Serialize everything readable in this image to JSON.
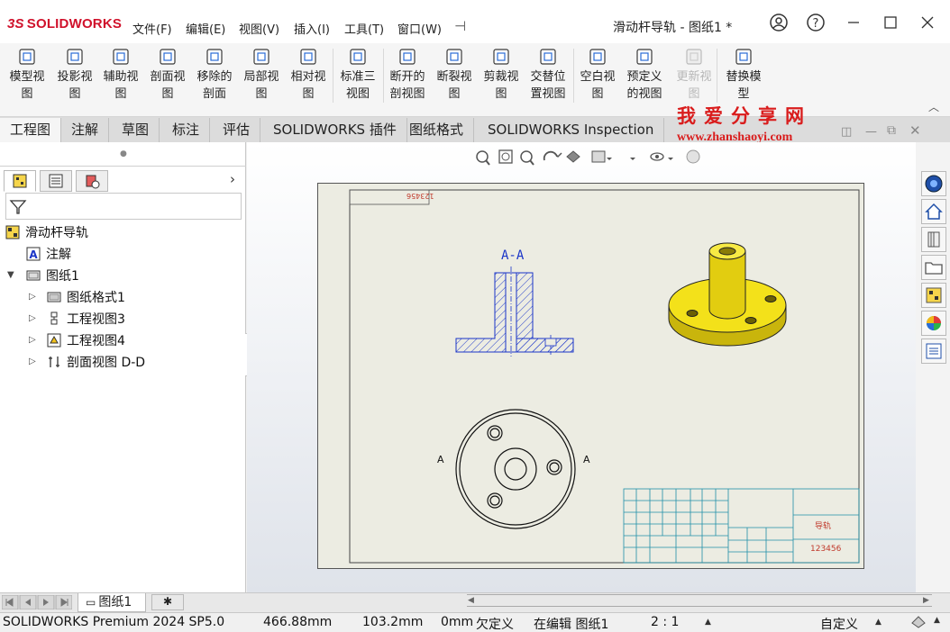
{
  "app": {
    "logo_prefix": "3S",
    "logo_text": "SOLIDWORKS",
    "window_title": "滑动杆导轨 - 图纸1 *"
  },
  "menu": [
    "文件(F)",
    "编辑(E)",
    "视图(V)",
    "插入(I)",
    "工具(T)",
    "窗口(W)"
  ],
  "ribbon": [
    {
      "line1": "模型视",
      "line2": "图",
      "icon": "model-view-icon"
    },
    {
      "line1": "投影视",
      "line2": "图",
      "icon": "projected-view-icon"
    },
    {
      "line1": "辅助视",
      "line2": "图",
      "icon": "auxiliary-view-icon"
    },
    {
      "line1": "剖面视",
      "line2": "图",
      "icon": "section-view-icon"
    },
    {
      "line1": "移除的",
      "line2": "剖面",
      "icon": "removed-section-icon"
    },
    {
      "line1": "局部视",
      "line2": "图",
      "icon": "detail-view-icon"
    },
    {
      "line1": "相对视",
      "line2": "图",
      "icon": "relative-view-icon"
    },
    {
      "line1": "标准三",
      "line2": "视图",
      "icon": "standard-3-view-icon"
    },
    {
      "line1": "断开的",
      "line2": "剖视图",
      "icon": "broken-out-section-icon"
    },
    {
      "line1": "断裂视",
      "line2": "图",
      "icon": "break-view-icon"
    },
    {
      "line1": "剪裁视",
      "line2": "图",
      "icon": "crop-view-icon"
    },
    {
      "line1": "交替位",
      "line2": "置视图",
      "icon": "alternate-position-icon"
    },
    {
      "line1": "空白视",
      "line2": "图",
      "icon": "empty-view-icon"
    },
    {
      "line1": "预定义",
      "line2": "的视图",
      "icon": "predefined-view-icon"
    },
    {
      "line1": "更新视",
      "line2": "图",
      "icon": "update-view-icon",
      "disabled": true
    },
    {
      "line1": "替换模",
      "line2": "型",
      "icon": "replace-model-icon"
    }
  ],
  "tabs": [
    "工程图",
    "注解",
    "草图",
    "标注",
    "评估",
    "SOLIDWORKS 插件",
    "图纸格式",
    "SOLIDWORKS Inspection"
  ],
  "watermark": {
    "line1": "我爱分享网",
    "line2": "www.zhanshaoyi.com"
  },
  "tree": {
    "root": "滑动杆导轨",
    "annotations": "注解",
    "sheet": "图纸1",
    "children": [
      "图纸格式1",
      "工程视图3",
      "工程视图4",
      "剖面视图 D-D"
    ]
  },
  "drawing": {
    "section_label": "A-A",
    "stamp": "123456",
    "title_name": "导轨",
    "title_number": "123456",
    "section_callout_left": "A",
    "section_callout_right": "A"
  },
  "sheet_tab": "图纸1",
  "status": {
    "product": "SOLIDWORKS Premium 2024 SP5.0",
    "x": "466.88mm",
    "y": "103.2mm",
    "z": "0mm",
    "definition": "欠定义",
    "editing": "在编辑 图纸1",
    "scale": "2 : 1",
    "units": "自定义"
  },
  "colors": {
    "brand_red": "#d0112b",
    "part_yellow": "#f3e11a",
    "annotation_blue": "#1a35c8",
    "title_block_cyan": "#1f8fa8",
    "watermark_red": "#d91c1c"
  }
}
